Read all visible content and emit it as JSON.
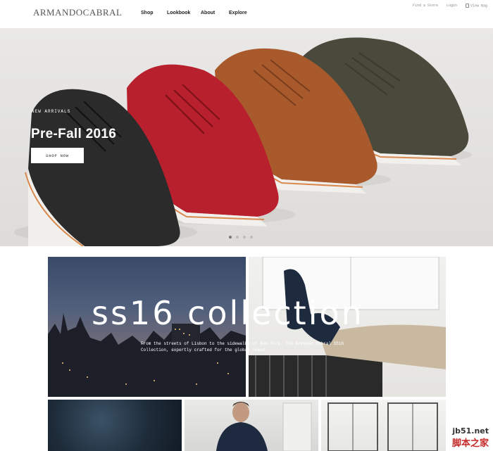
{
  "header": {
    "logo": "ARMANDOCABRAL",
    "nav": [
      {
        "label": "Shop"
      },
      {
        "label": "Lookbook"
      },
      {
        "label": "About"
      },
      {
        "label": "Explore"
      }
    ],
    "utility": {
      "find_store": "Find a Store",
      "login": "Login",
      "bag": "View Bag"
    }
  },
  "hero": {
    "eyebrow": "NEW ARRIVALS",
    "title": "Pre-Fall 2016",
    "cta": "SHOP NOW",
    "slides": 4,
    "active_slide": 1
  },
  "collection": {
    "title": "ss16 collection",
    "description": "From the streets of Lisbon to the sidewalks of New York. The Armando Cabral SS16 Collection, expertly crafted for the global nomad."
  },
  "watermark": {
    "site": "jb51.net",
    "name": "脚本之家"
  },
  "colors": {
    "shoe_black": "#2b2b2b",
    "shoe_red": "#b8202e",
    "shoe_tan": "#a85a2c",
    "shoe_olive": "#4a4a3c",
    "sole": "#f2f0ec",
    "welt": "#d9894e"
  }
}
